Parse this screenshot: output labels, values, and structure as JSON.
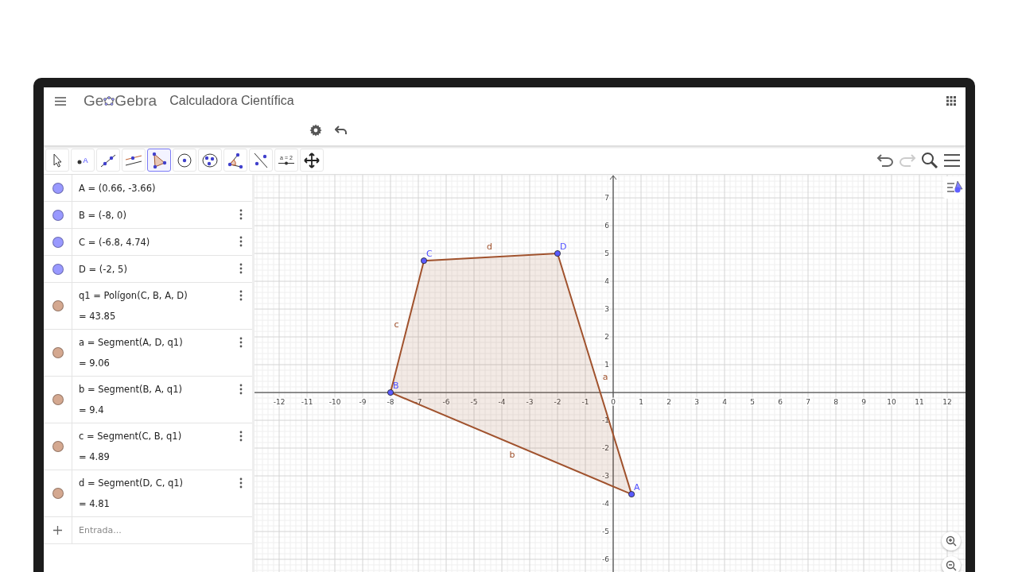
{
  "header": {
    "logo": [
      "Ge",
      "Gebra"
    ],
    "title": "Calculadora Científica"
  },
  "tools": [
    {
      "kind": "move",
      "selected": false
    },
    {
      "kind": "point",
      "label": "A",
      "selected": false
    },
    {
      "kind": "line",
      "selected": false
    },
    {
      "kind": "parallel",
      "selected": false
    },
    {
      "kind": "polygon",
      "selected": true
    },
    {
      "kind": "circle",
      "selected": false
    },
    {
      "kind": "conic",
      "selected": false
    },
    {
      "kind": "angle",
      "selected": false
    },
    {
      "kind": "reflect",
      "selected": false
    },
    {
      "kind": "slider",
      "label": "a = 2",
      "selected": false
    },
    {
      "kind": "pan",
      "selected": false
    }
  ],
  "toolbar_right": {
    "undo": {
      "disabled": false
    },
    "redo": {
      "disabled": true
    }
  },
  "algebra": {
    "items": [
      {
        "color": "#9999ff",
        "text": "A = (0.66, -3.66)",
        "menu": false
      },
      {
        "color": "#9999ff",
        "text": "B = (-8, 0)",
        "menu": true
      },
      {
        "color": "#9999ff",
        "text": "C = (-6.8, 4.74)",
        "menu": true
      },
      {
        "color": "#9999ff",
        "text": "D = (-2, 5)",
        "menu": true
      },
      {
        "color": "#d4a890",
        "text": "q1 = Polígon(C, B, A, D)",
        "value": "= 43.85",
        "menu": true
      },
      {
        "color": "#d4a890",
        "text": "a = Segment(A, D, q1)",
        "value": "= 9.06",
        "menu": true
      },
      {
        "color": "#d4a890",
        "text": "b = Segment(B, A, q1)",
        "value": "= 9.4",
        "menu": true
      },
      {
        "color": "#d4a890",
        "text": "c = Segment(C, B, q1)",
        "value": "= 4.89",
        "menu": true
      },
      {
        "color": "#d4a890",
        "text": "d = Segment(D, C, q1)",
        "value": "= 4.81",
        "menu": true
      }
    ],
    "input": {
      "placeholder": "Entrada..."
    }
  },
  "graphics": {
    "point_labels": [
      "C",
      "B",
      "A",
      "D"
    ],
    "segment_labels": [
      "c",
      "b",
      "a",
      "d"
    ],
    "chart_data": {
      "type": "area",
      "grid": true,
      "x": [
        -6.8,
        -8,
        0.66,
        -2
      ],
      "series": [
        {
          "color": "#a0522d",
          "values": [
            4.74,
            0,
            -3.66,
            5
          ]
        }
      ],
      "xlim": [
        -12.886,
        12.657
      ],
      "ylim": [
        -6.457,
        7.83
      ],
      "xticks": [
        -12,
        -11,
        -10,
        -9,
        -8,
        -7,
        -6,
        -5,
        -4,
        -3,
        -2,
        -1,
        0,
        1,
        2,
        3,
        4,
        5,
        6,
        7,
        8,
        9,
        10,
        11,
        12
      ],
      "yticks": [
        -6,
        -5,
        -4,
        -3,
        -2,
        -1,
        1,
        2,
        3,
        4,
        5,
        6,
        7
      ]
    }
  }
}
